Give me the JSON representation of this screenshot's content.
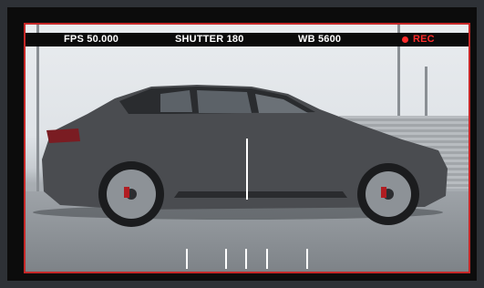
{
  "hud": {
    "fps": "FPS 50.000",
    "shutter": "SHUTTER 180",
    "wb": "WB 5600",
    "rec": "REC"
  },
  "colors": {
    "frame_line": "#c62828",
    "rec": "#ff2b2b",
    "hud_bg": "#0b0b0b",
    "hud_text": "#ffffff"
  },
  "icons": {
    "record_indicator": "record-dot-icon"
  }
}
